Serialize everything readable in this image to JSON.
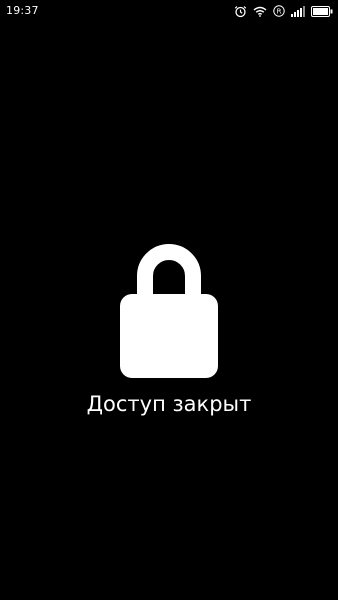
{
  "status_bar": {
    "time": "19:37",
    "icons": [
      "alarm-icon",
      "wifi-icon",
      "roaming-icon",
      "signal-icon",
      "battery-icon"
    ],
    "roaming_letter": "R"
  },
  "screen": {
    "lock_icon": "lock-icon",
    "message": "Доступ закрыт"
  },
  "colors": {
    "background": "#000000",
    "foreground": "#ffffff"
  }
}
